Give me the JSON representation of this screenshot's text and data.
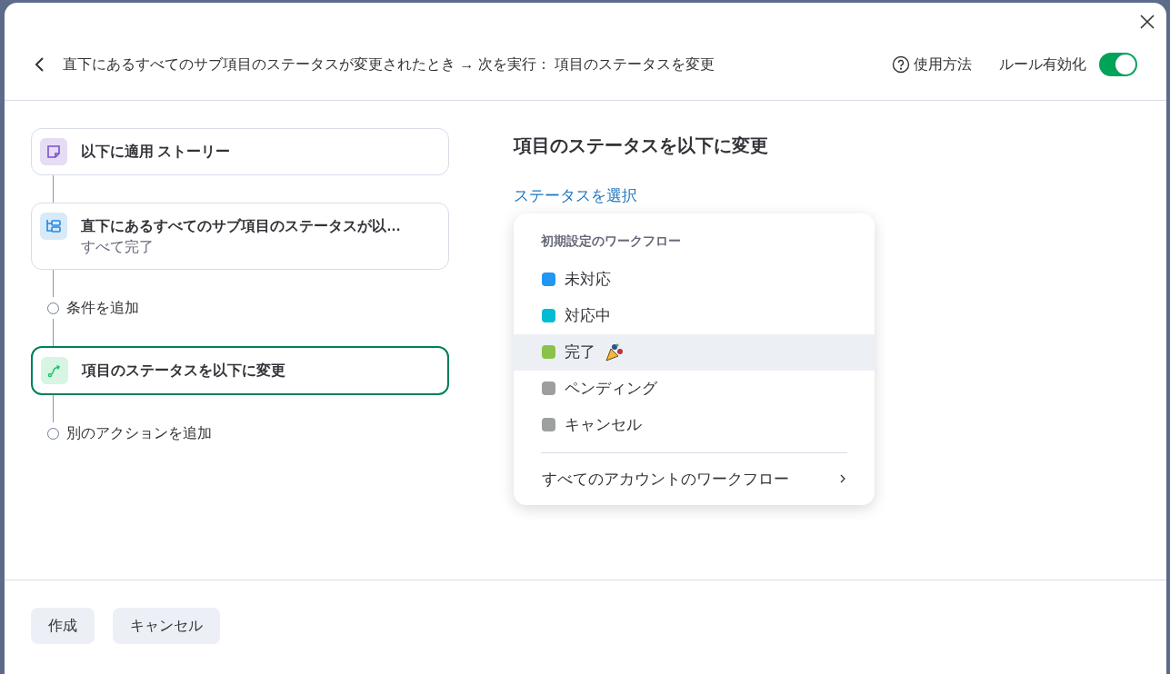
{
  "header": {
    "title": "直下にあるすべてのサブ項目のステータスが変更されたとき → 次を実行： 項目のステータスを変更",
    "help": "使用方法",
    "toggle_label": "ルール有効化",
    "toggle_on": true
  },
  "steps": [
    {
      "kind": "card",
      "title": "以下に適用 ストーリー",
      "selected": false
    },
    {
      "kind": "card",
      "title": "直下にあるすべてのサブ項目のステータスが以…",
      "subtitle": "すべて完了",
      "selected": false
    },
    {
      "kind": "add",
      "title": "条件を追加"
    },
    {
      "kind": "card",
      "title": "項目のステータスを以下に変更",
      "selected": true
    },
    {
      "kind": "add",
      "title": "別のアクションを追加"
    }
  ],
  "panel": {
    "heading": "項目のステータスを以下に変更",
    "link": "ステータスを選択",
    "dropdown": {
      "section": "初期設定のワークフロー",
      "options": [
        {
          "label": "未対応",
          "color": "#2196f3",
          "kind": "plain",
          "selected": false
        },
        {
          "label": "対応中",
          "color": "#00bcd4",
          "kind": "plain",
          "selected": false
        },
        {
          "label": "完了",
          "color": "#8bc34a",
          "kind": "celebrate",
          "selected": true
        },
        {
          "label": "ペンディング",
          "color": "#9e9e9e",
          "kind": "plain",
          "selected": false
        },
        {
          "label": "キャンセル",
          "color": "#9e9f9f",
          "kind": "plain",
          "selected": false
        }
      ],
      "more": "すべてのアカウントのワークフロー"
    }
  },
  "buttons": [
    "作成",
    "キャンセル"
  ]
}
